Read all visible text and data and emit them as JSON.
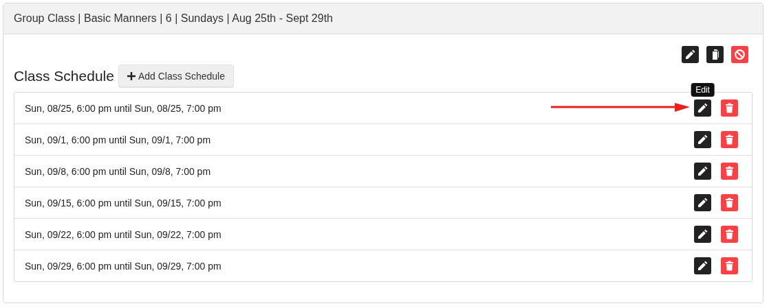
{
  "panel": {
    "title": "Group Class | Basic Manners | 6 | Sundays | Aug 25th - Sept 29th"
  },
  "toolbar": [
    {
      "kind": "edit"
    },
    {
      "kind": "copy"
    },
    {
      "kind": "cancel"
    }
  ],
  "section": {
    "title": "Class Schedule",
    "add_button": "Add Class Schedule"
  },
  "rows": [
    {
      "text": "Sun, 08/25, 6:00 pm until Sun, 08/25, 7:00 pm",
      "tooltip": "Edit",
      "pointed_at": true
    },
    {
      "text": "Sun, 09/1, 6:00 pm until Sun, 09/1, 7:00 pm",
      "pointed_at": false
    },
    {
      "text": "Sun, 09/8, 6:00 pm until Sun, 09/8, 7:00 pm",
      "pointed_at": false
    },
    {
      "text": "Sun, 09/15, 6:00 pm until Sun, 09/15, 7:00 pm",
      "pointed_at": false
    },
    {
      "text": "Sun, 09/22, 6:00 pm until Sun, 09/22, 7:00 pm",
      "pointed_at": false
    },
    {
      "text": "Sun, 09/29, 6:00 pm until Sun, 09/29, 7:00 pm",
      "pointed_at": false
    }
  ]
}
